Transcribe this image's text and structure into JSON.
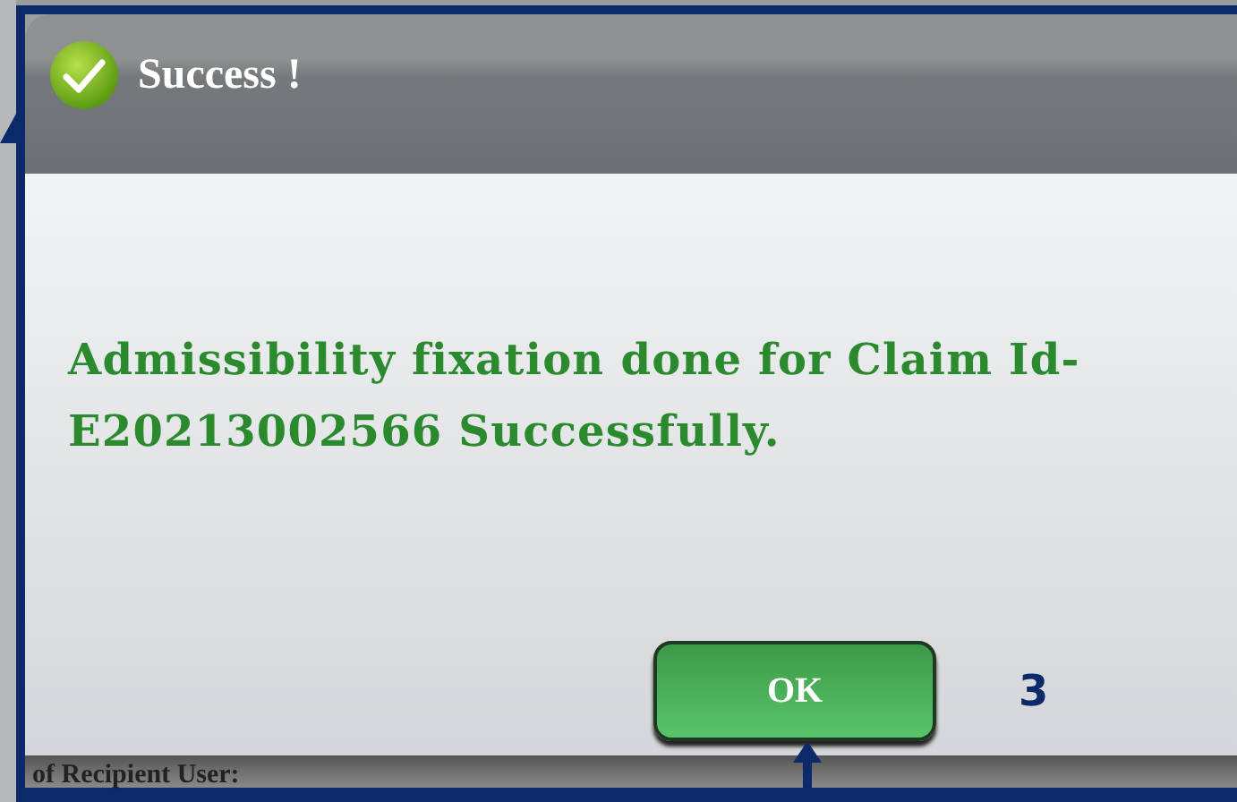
{
  "background": {
    "bottom_text": "of Recipient User:"
  },
  "dialog": {
    "title": "Success !",
    "message": "Admissibility fixation done for Claim Id-E20213002566 Successfully.",
    "buttons": [
      "OK"
    ]
  },
  "annotation": {
    "label": "3"
  }
}
